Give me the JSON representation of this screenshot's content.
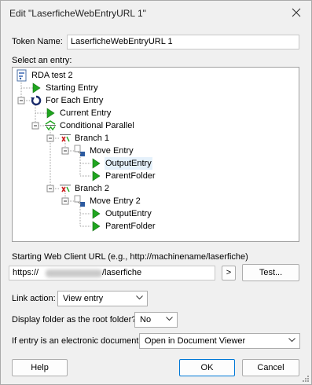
{
  "window": {
    "title": "Edit \"LaserficheWebEntryURL 1\""
  },
  "token": {
    "label": "Token Name:",
    "value": "LaserficheWebEntryURL 1"
  },
  "entry_select": {
    "label": "Select an entry:"
  },
  "tree": {
    "root": "RDA test 2",
    "starting_entry": "Starting Entry",
    "for_each": "For Each Entry",
    "current_entry": "Current Entry",
    "conditional_parallel": "Conditional Parallel",
    "branch1": "Branch 1",
    "move_entry": "Move Entry",
    "output_entry_1": "OutputEntry",
    "parent_folder_1": "ParentFolder",
    "branch2": "Branch 2",
    "move_entry_2": "Move Entry 2",
    "output_entry_2": "OutputEntry",
    "parent_folder_2": "ParentFolder"
  },
  "url": {
    "label": "Starting Web Client URL (e.g., http://machinename/laserfiche)",
    "prefix": "https://",
    "suffix": "/laserfiche",
    "arrow_label": ">",
    "test_label": "Test..."
  },
  "link_action": {
    "label": "Link action:",
    "value": "View entry"
  },
  "root_folder": {
    "label": "Display folder as the root folder?",
    "value": "No"
  },
  "electronic_doc": {
    "label": "If entry is an electronic document:",
    "value": "Open in Document Viewer"
  },
  "buttons": {
    "help": "Help",
    "ok": "OK",
    "cancel": "Cancel"
  },
  "colors": {
    "accent": "#0078d7",
    "play_green": "#1fa51f",
    "selection": "#e5f1fb",
    "branch_red": "#cc2222"
  }
}
